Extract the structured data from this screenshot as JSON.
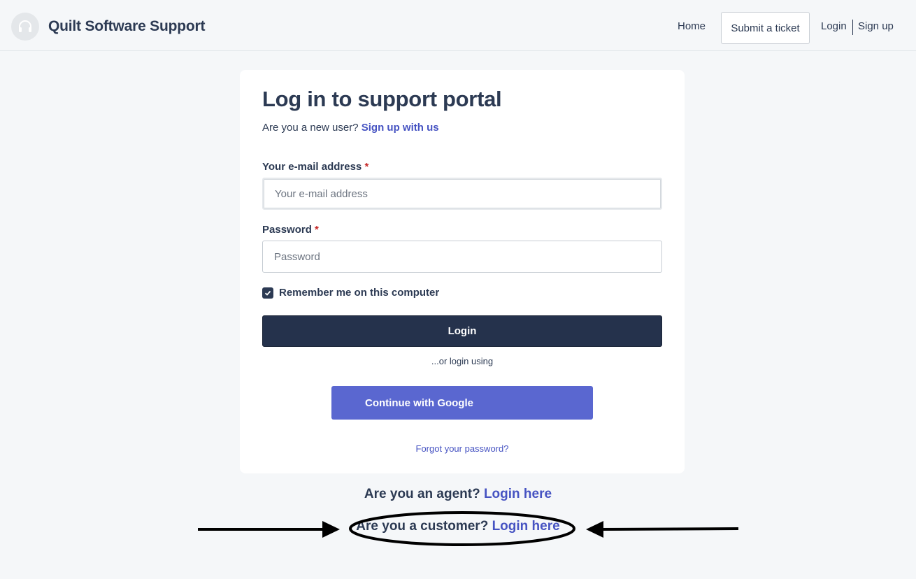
{
  "header": {
    "brand": "Quilt Software Support",
    "logo_icon": "headset-icon",
    "nav": {
      "home": "Home",
      "submit_ticket": "Submit a ticket",
      "login": "Login",
      "signup": "Sign up"
    }
  },
  "login_form": {
    "title": "Log in to support portal",
    "new_user_prompt": "Are you a new user?",
    "signup_link": "Sign up with us",
    "email": {
      "label": "Your e-mail address",
      "required_mark": "*",
      "value": "",
      "placeholder": "Your e-mail address"
    },
    "password": {
      "label": "Password",
      "required_mark": "*",
      "value": "",
      "placeholder": "Password"
    },
    "remember": {
      "label": "Remember me on this computer",
      "checked": true
    },
    "login_button": "Login",
    "or_text": "...or login using",
    "google_button": "Continue with Google",
    "forgot_link": "Forgot your password?"
  },
  "footer_links": {
    "agent_prompt": "Are you an agent?",
    "agent_link": "Login here",
    "customer_prompt": "Are you a customer?",
    "customer_link": "Login here"
  },
  "colors": {
    "page_bg": "#f5f7f9",
    "primary_dark": "#25324c",
    "link": "#4653c2",
    "google_button": "#5a67d0",
    "required": "#c62828"
  }
}
